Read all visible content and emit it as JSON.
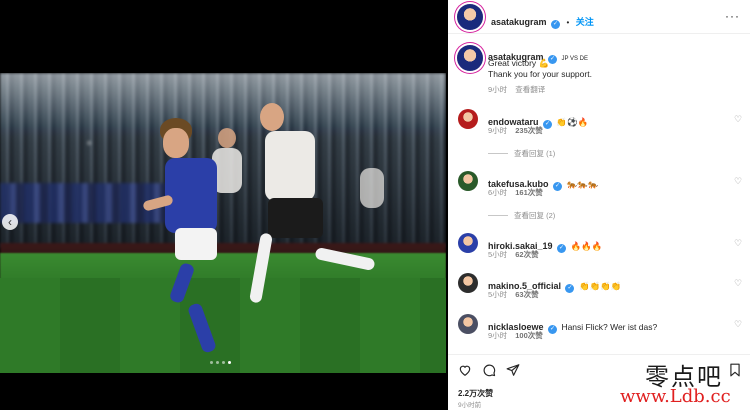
{
  "post": {
    "carousel_dots_total": 4,
    "carousel_active_index": 3,
    "prev_arrow_glyph": "‹"
  },
  "header": {
    "username": "asatakugram",
    "verified_glyph": "✓",
    "separator": "•",
    "follow_label": "关注",
    "more_glyph": "···"
  },
  "caption": {
    "username": "asatakugram",
    "tag": "JP VS DE",
    "line1": "Great victory 💪",
    "line2": "Thank you for your support.",
    "time": "9小时",
    "translate_label": "查看翻译"
  },
  "comments": [
    {
      "username": "endowataru",
      "text": "👏⚽🔥",
      "time": "9小时",
      "likes": "235次赞",
      "view_replies": "查看回复 (1)"
    },
    {
      "username": "takefusa.kubo",
      "text": "🐅🐅🐅",
      "time": "6小时",
      "likes": "161次赞",
      "view_replies": "查看回复 (2)"
    },
    {
      "username": "hiroki.sakai_19",
      "text": "🔥🔥🔥",
      "time": "5小时",
      "likes": "62次赞"
    },
    {
      "username": "makino.5_official",
      "text": "👏👏👏👏",
      "time": "5小时",
      "likes": "63次赞"
    },
    {
      "username": "nicklasloewe",
      "text": "Hansi Flick? Wer ist das?",
      "time": "9小时",
      "likes": "100次赞"
    }
  ],
  "actions": {
    "like_icon": "heart-icon",
    "comment_icon": "comment-icon",
    "share_icon": "share-icon",
    "save_icon": "bookmark-icon",
    "likes_count": "2.2万次赞",
    "time_ago": "9小时前"
  },
  "watermark": {
    "cn": "零点吧",
    "url": "www.Ldb.cc"
  },
  "colors": {
    "link_blue": "#0095f6",
    "verified_blue": "#3897f0",
    "muted": "#8e8e8e",
    "watermark_red": "#e02020"
  }
}
